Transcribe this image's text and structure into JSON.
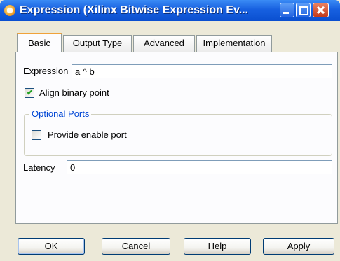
{
  "window": {
    "title": "Expression (Xilinx Bitwise Expression Ev...",
    "icon": "sysgen-icon"
  },
  "tabs": [
    {
      "label": "Basic",
      "active": true
    },
    {
      "label": "Output Type",
      "active": false
    },
    {
      "label": "Advanced",
      "active": false
    },
    {
      "label": "Implementation",
      "active": false
    }
  ],
  "basic": {
    "expression_label": "Expression",
    "expression_value": "a ^ b",
    "align_binary_point_label": "Align binary point",
    "align_binary_point_checked": true,
    "optional_ports_title": "Optional Ports",
    "provide_enable_port_label": "Provide enable port",
    "provide_enable_port_checked": false,
    "latency_label": "Latency",
    "latency_value": "0"
  },
  "buttons": {
    "ok": "OK",
    "cancel": "Cancel",
    "help": "Help",
    "apply": "Apply"
  },
  "colors": {
    "titlebar": "#0a4fd0",
    "group_title": "#0046d5",
    "active_tab_accent": "#f0a23a",
    "checkmark": "#21a121"
  }
}
